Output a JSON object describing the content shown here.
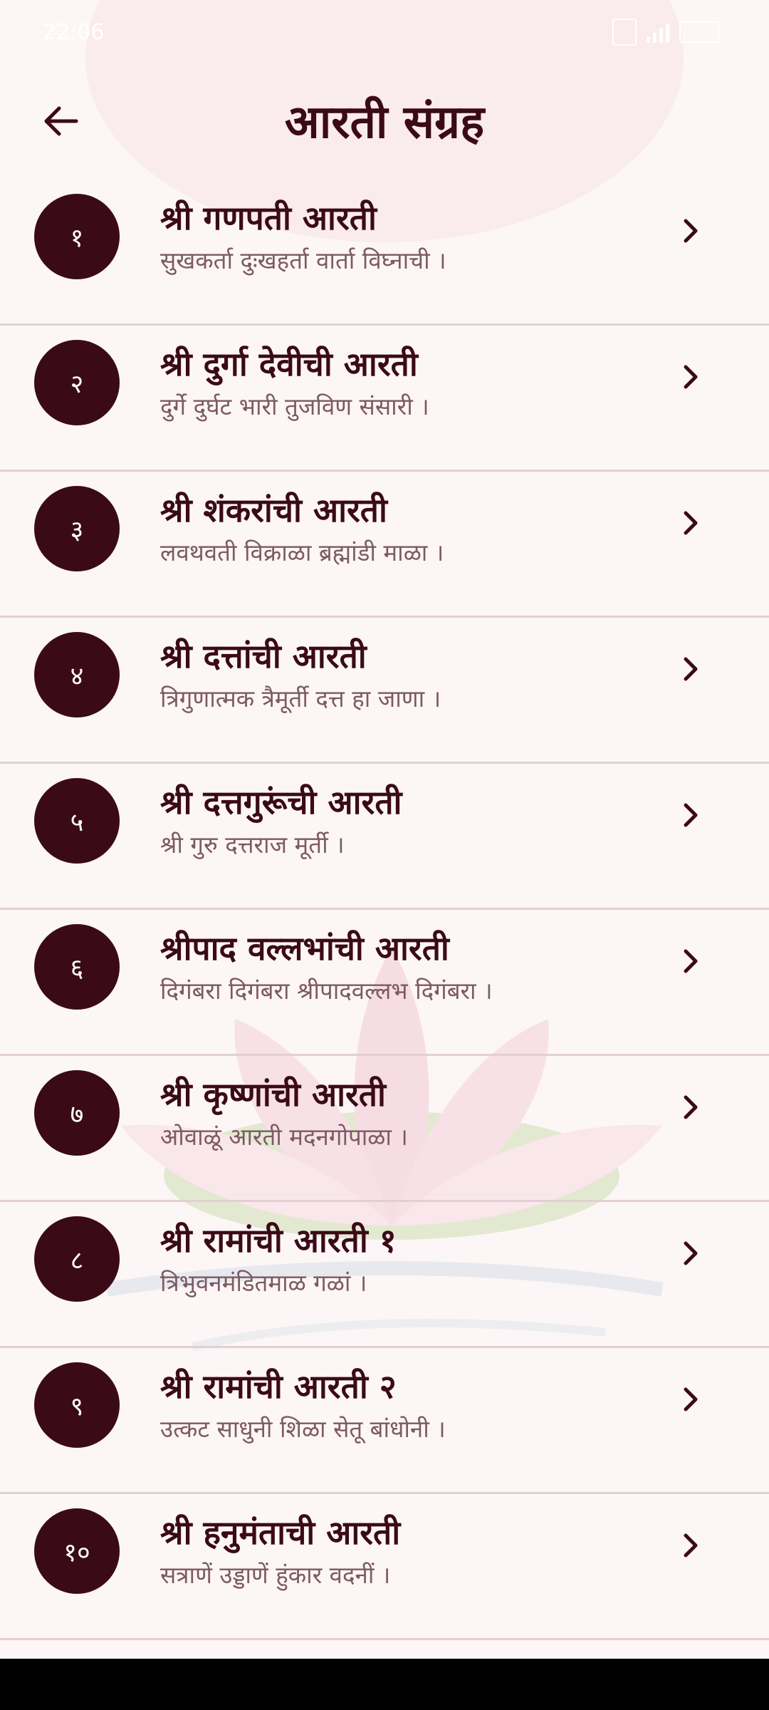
{
  "status": {
    "time": "22:06"
  },
  "header": {
    "title": "आरती संग्रह"
  },
  "items": [
    {
      "number": "१",
      "title": "श्री गणपती आरती",
      "subtitle": "सुखकर्ता दुःखहर्ता वार्ता विघ्नाची ।"
    },
    {
      "number": "२",
      "title": "श्री दुर्गा देवीची आरती",
      "subtitle": "दुर्गे दुर्घट भारी तुजविण संसारी ।"
    },
    {
      "number": "३",
      "title": "श्री शंकरांची आरती",
      "subtitle": "लवथवती विक्राळा ब्रह्मांडी माळा ।"
    },
    {
      "number": "४",
      "title": "श्री दत्तांची आरती",
      "subtitle": "त्रिगुणात्मक त्रैमूर्ती दत्त हा जाणा ।"
    },
    {
      "number": "५",
      "title": "श्री दत्तगुरूंची आरती",
      "subtitle": "श्री गुरु दत्तराज मूर्ती ।"
    },
    {
      "number": "६",
      "title": "श्रीपाद वल्लभांची आरती",
      "subtitle": "दिगंबरा दिगंबरा श्रीपादवल्लभ दिगंबरा ।"
    },
    {
      "number": "७",
      "title": "श्री कृष्णांची आरती",
      "subtitle": "ओवाळूं आरती मदनगोपाळा ।"
    },
    {
      "number": "८",
      "title": "श्री रामांची आरती १",
      "subtitle": "त्रिभुवनमंडितमाळ गळां ।"
    },
    {
      "number": "९",
      "title": "श्री रामांची आरती २",
      "subtitle": "उत्कट साधुनी शिळा सेतू बांधोनी ।"
    },
    {
      "number": "१०",
      "title": "श्री हनुमंताची आरती",
      "subtitle": "सत्राणें उड्डाणें हुंकार वदनीं ।"
    }
  ],
  "colors": {
    "accent": "#3a0b17",
    "title": "#3b0a18",
    "subtitle": "#7d5a63",
    "background": "#fdf6f6"
  }
}
